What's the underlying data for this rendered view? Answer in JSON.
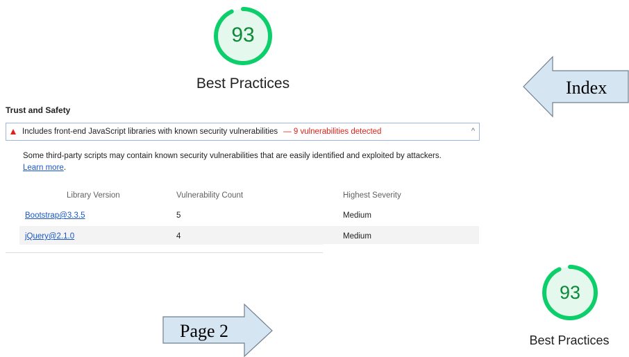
{
  "score_top": {
    "value": "93",
    "label": "Best Practices",
    "fraction": 0.93
  },
  "score_bottom": {
    "value": "93",
    "label": "Best Practices",
    "fraction": 0.93
  },
  "section": {
    "title": "Trust and Safety"
  },
  "audit": {
    "title": "Includes front-end JavaScript libraries with known security vulnerabilities",
    "display_value": "— 9 vulnerabilities detected",
    "description": "Some third-party scripts may contain known security vulnerabilities that are easily identified and exploited by attackers.",
    "learn_more": "Learn more",
    "learn_more_suffix": "."
  },
  "table": {
    "headers": [
      "Library Version",
      "Vulnerability Count",
      "Highest Severity"
    ],
    "rows": [
      {
        "library": "Bootstrap@3.3.5",
        "count": "5",
        "severity": "Medium"
      },
      {
        "library": "jQuery@2.1.0",
        "count": "4",
        "severity": "Medium"
      }
    ]
  },
  "nav": {
    "index_label": "Index",
    "page2_label": "Page 2"
  },
  "colors": {
    "pass_green": "#0cce6b",
    "pass_text": "#0c8a3a",
    "gauge_fill": "#e5f8ee",
    "fail_red": "#e0211a",
    "link_blue": "#1a56c8",
    "arrow_fill": "#d6e5f2",
    "arrow_stroke": "#6f7f90"
  },
  "icons": {
    "warning": "warning-triangle-icon",
    "chevron": "chevron-up-icon"
  }
}
